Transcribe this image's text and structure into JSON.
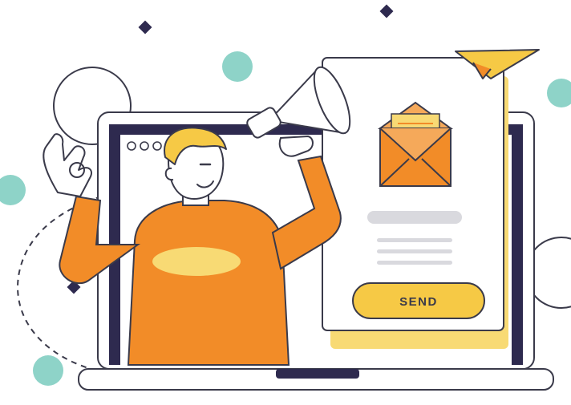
{
  "button": {
    "label": "SEND"
  },
  "colors": {
    "orange": "#F28C28",
    "light_orange": "#F5A95A",
    "yellow": "#F6C945",
    "pale_yellow": "#F8DA74",
    "teal": "#8ED3C8",
    "navy": "#2E2A4F",
    "outline": "#3A3A4A",
    "gray": "#D9D9DE",
    "skin": "#FFFFFF",
    "hair": "#F6C945"
  },
  "icons": {
    "megaphone": "megaphone-icon",
    "paper_plane": "paper-plane-icon",
    "envelope": "open-envelope-icon",
    "browser_dots": "window-dots-icon",
    "sparkle": "diamond-sparkle-icon"
  }
}
